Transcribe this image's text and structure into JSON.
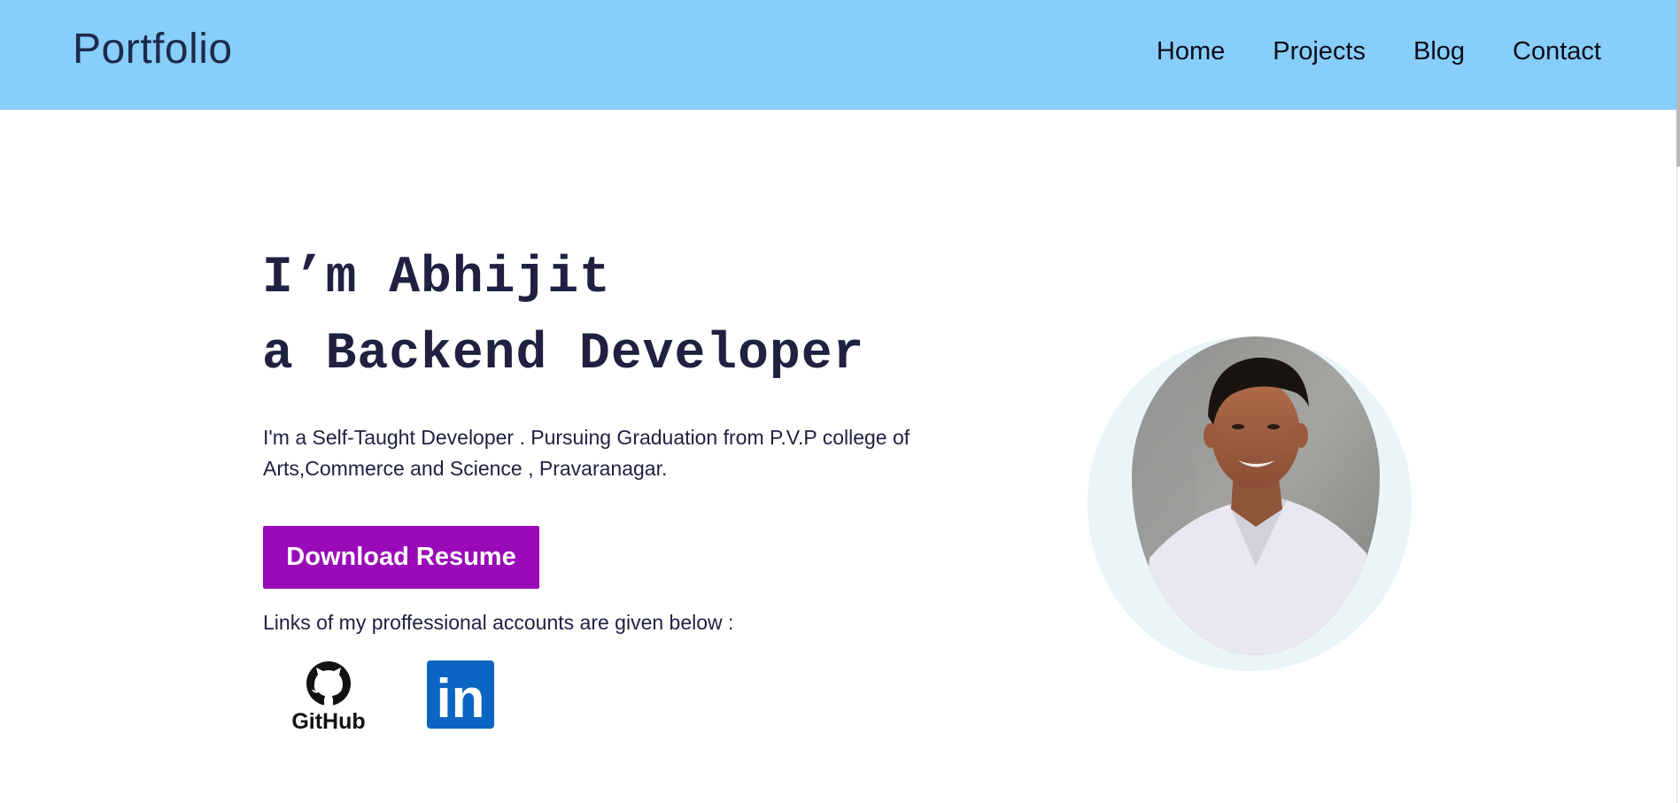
{
  "header": {
    "brand": "Portfolio",
    "nav": [
      "Home",
      "Projects",
      "Blog",
      "Contact"
    ]
  },
  "hero": {
    "title_line1": "I’m Abhijit",
    "title_line2": "a Backend Developer",
    "intro": "I'm a Self-Taught Developer . Pursuing Graduation from P.V.P college of Arts,Commerce and Science , Pravaranagar.",
    "download_button": "Download Resume",
    "links_text": "Links of my proffessional accounts are given below :"
  },
  "social": {
    "github_label": "GitHub",
    "linkedin_label": "in"
  },
  "icons": {
    "github": "github-logo-icon",
    "linkedin": "linkedin-logo-icon"
  },
  "colors": {
    "navbar": "#87cefa",
    "text": "#1e2140",
    "button": "#9a0ab8",
    "linkedin": "#0a66c2"
  }
}
